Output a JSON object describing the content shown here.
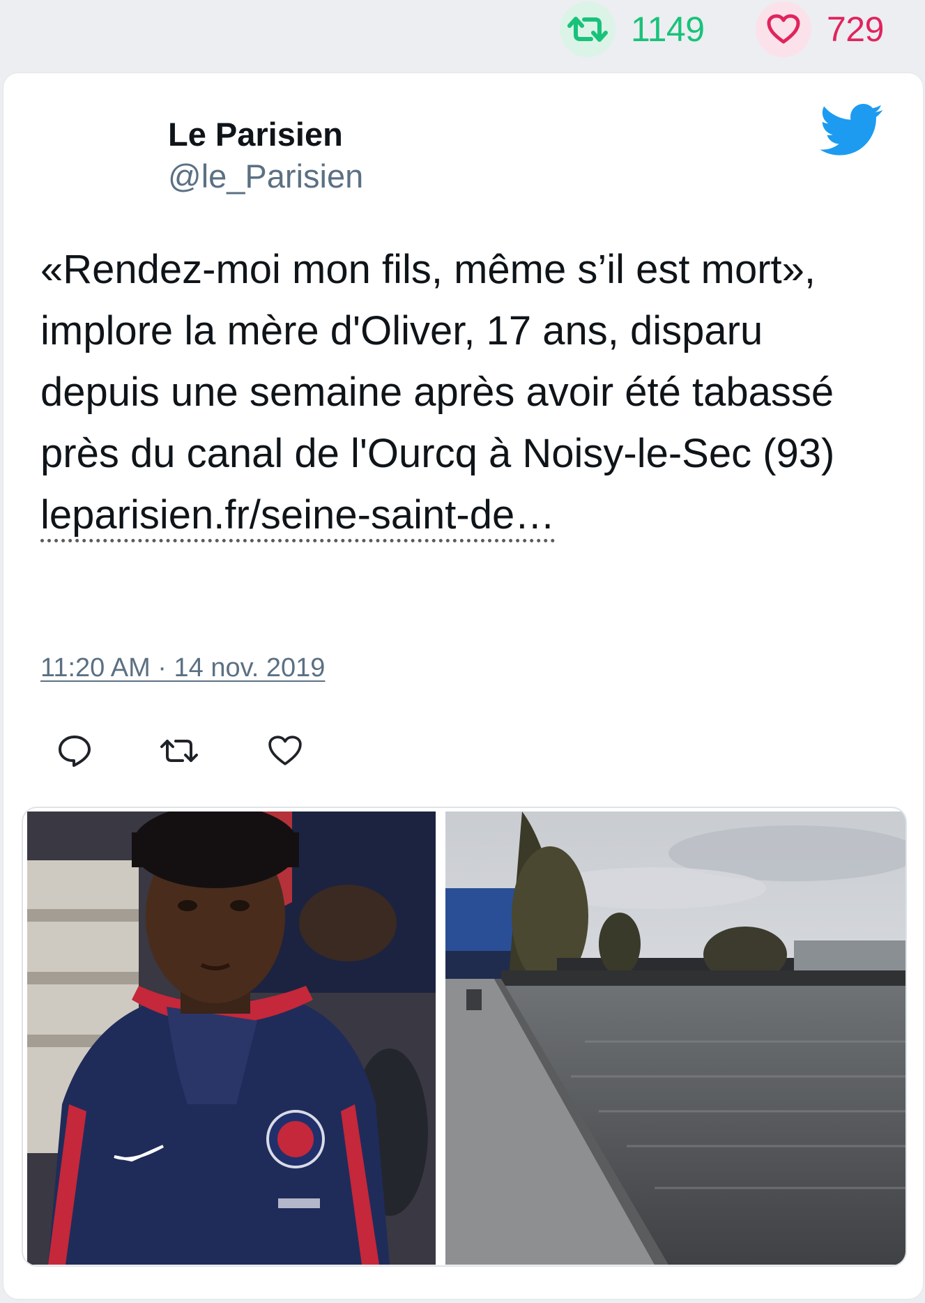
{
  "engagement": {
    "retweet_count": "1149",
    "like_count": "729",
    "colors": {
      "retweet": "#19c27a",
      "like": "#e0245e"
    }
  },
  "tweet": {
    "author_name": "Le Parisien",
    "author_handle": "@le_Parisien",
    "text": "«Rendez-moi mon fils, même s’il est mort», implore la mère d'Oliver, 17 ans, disparu depuis une semaine après avoir été tabassé près du canal de l'Ourcq à Noisy-le-Sec (93) ",
    "link_text": "leparisien.fr/seine-saint-de…",
    "timestamp": "11:20 AM · 14 nov. 2019",
    "icons": [
      "twitter-bird-icon",
      "reply-icon",
      "retweet-icon",
      "like-icon"
    ]
  }
}
